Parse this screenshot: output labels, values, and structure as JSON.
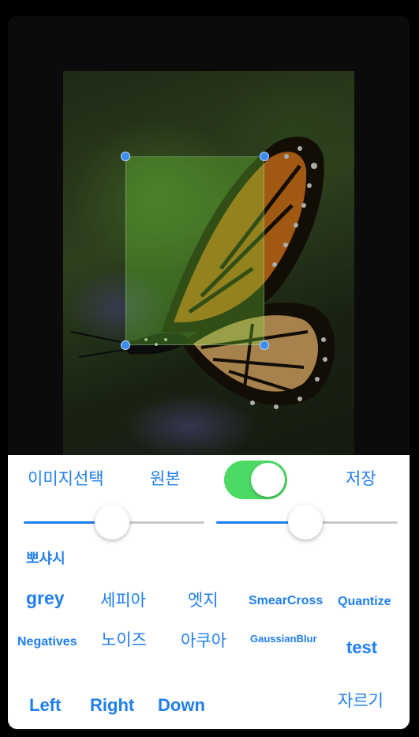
{
  "toolbar": {
    "select_image": "이미지선택",
    "original": "원본",
    "save": "저장",
    "toggle_on": true
  },
  "sliders": [
    {
      "name": "slider-1",
      "value": 0.49
    },
    {
      "name": "slider-2",
      "value": 0.49
    }
  ],
  "filters": {
    "sharpen": "뽀샤시",
    "grey": "grey",
    "sepia": "세피아",
    "edge": "엣지",
    "smearcross": "SmearCross",
    "quantize": "Quantize",
    "negatives": "Negatives",
    "noise": "노이즈",
    "aqua": "아쿠아",
    "gaussianblur": "GaussianBlur",
    "test": "test"
  },
  "movement": {
    "left": "Left",
    "right": "Right",
    "down": "Down",
    "crop": "자르기"
  },
  "colors": {
    "accent": "#1f7ef0",
    "toggle_on": "#4cd964",
    "crop_overlay": "#78e63c",
    "handle": "#3b8cf0"
  }
}
